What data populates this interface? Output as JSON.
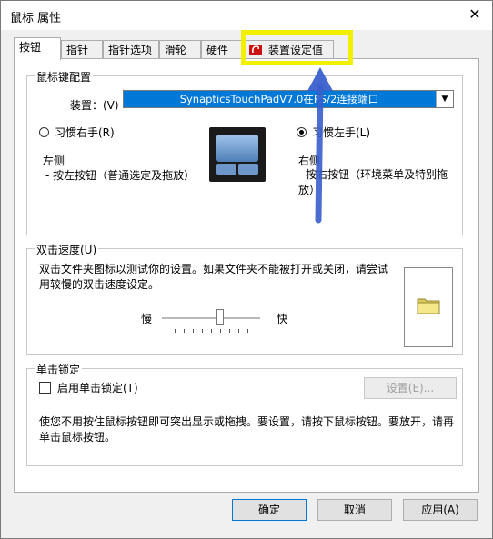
{
  "window": {
    "title": "鼠标 属性",
    "close_glyph": "✕"
  },
  "tabs": [
    {
      "label": "按钮",
      "active": true
    },
    {
      "label": "指针"
    },
    {
      "label": "指针选项"
    },
    {
      "label": "滑轮"
    },
    {
      "label": "硬件"
    },
    {
      "label": "装置设定值"
    }
  ],
  "buttons_group": {
    "title": "鼠标键配置",
    "device_label": "装置：(V)",
    "device_value": "SynapticsTouchPadV7.0在PS/2连接端口",
    "right_hand": "习惯右手(R)",
    "left_hand": "习惯左手(L)",
    "left_side_title": "左侧",
    "left_side_desc": "- 按左按钮（普通选定及拖放）",
    "right_side_title": "右侧",
    "right_side_desc": "- 按右按钮（环境菜单及特别拖放）"
  },
  "double_click": {
    "title": "双击速度(U)",
    "desc": "双击文件夹图标以测试你的设置。如果文件夹不能被打开或关闭，请尝试用较慢的双击速度设定。",
    "slow": "慢",
    "fast": "快",
    "speed": 0.6
  },
  "click_lock": {
    "title": "单击锁定",
    "checkbox_label": "启用单击锁定(T)",
    "settings_button": "设置(E)...",
    "desc": "使您不用按住鼠标按钮即可突出显示或拖拽。要设置，请按下鼠标按钮。要放开，请再单击鼠标按钮。"
  },
  "footer": {
    "ok": "确定",
    "cancel": "取消",
    "apply": "应用(A)"
  },
  "colors": {
    "highlight": "#f2f000",
    "arrow": "#3a5fcd",
    "selection": "#0078d7"
  }
}
